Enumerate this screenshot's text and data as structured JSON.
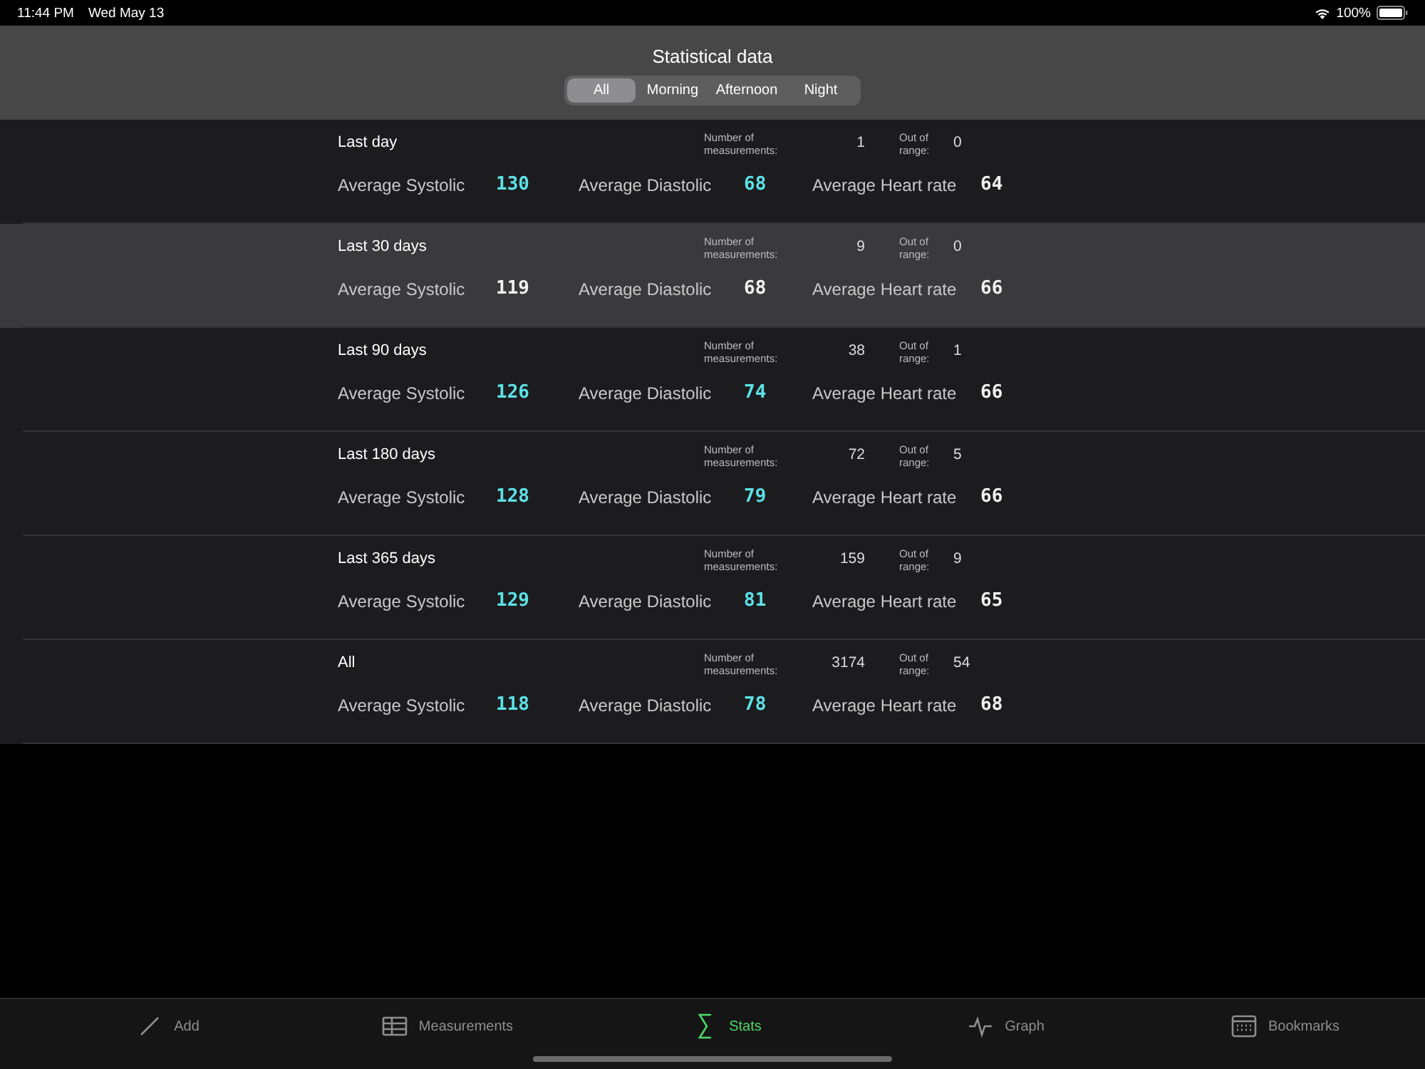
{
  "status_bar": {
    "time": "11:44 PM",
    "date": "Wed May 13",
    "battery": "100%"
  },
  "header": {
    "title": "Statistical data",
    "segments": [
      {
        "label": "All",
        "selected": true
      },
      {
        "label": "Morning",
        "selected": false
      },
      {
        "label": "Afternoon",
        "selected": false
      },
      {
        "label": "Night",
        "selected": false
      }
    ]
  },
  "rows": [
    {
      "period": "Last day",
      "selected": false,
      "count_label": "Number of measurements:",
      "count": "1",
      "range_label": "Out of range:",
      "out_of_range": "0",
      "stats": [
        {
          "label": "Average Systolic",
          "value": "130",
          "flagged": true
        },
        {
          "label": "Average Diastolic",
          "value": "68",
          "flagged": true
        },
        {
          "label": "Average Heart rate",
          "value": "64",
          "flagged": false
        }
      ]
    },
    {
      "period": "Last 30 days",
      "selected": true,
      "count_label": "Number of measurements:",
      "count": "9",
      "range_label": "Out of range:",
      "out_of_range": "0",
      "stats": [
        {
          "label": "Average Systolic",
          "value": "119",
          "flagged": false
        },
        {
          "label": "Average Diastolic",
          "value": "68",
          "flagged": false
        },
        {
          "label": "Average Heart rate",
          "value": "66",
          "flagged": false
        }
      ]
    },
    {
      "period": "Last 90 days",
      "selected": false,
      "count_label": "Number of measurements:",
      "count": "38",
      "range_label": "Out of range:",
      "out_of_range": "1",
      "stats": [
        {
          "label": "Average Systolic",
          "value": "126",
          "flagged": true
        },
        {
          "label": "Average Diastolic",
          "value": "74",
          "flagged": true
        },
        {
          "label": "Average Heart rate",
          "value": "66",
          "flagged": false
        }
      ]
    },
    {
      "period": "Last 180 days",
      "selected": false,
      "count_label": "Number of measurements:",
      "count": "72",
      "range_label": "Out of range:",
      "out_of_range": "5",
      "stats": [
        {
          "label": "Average Systolic",
          "value": "128",
          "flagged": true
        },
        {
          "label": "Average Diastolic",
          "value": "79",
          "flagged": true
        },
        {
          "label": "Average Heart rate",
          "value": "66",
          "flagged": false
        }
      ]
    },
    {
      "period": "Last 365 days",
      "selected": false,
      "count_label": "Number of measurements:",
      "count": "159",
      "range_label": "Out of range:",
      "out_of_range": "9",
      "stats": [
        {
          "label": "Average Systolic",
          "value": "129",
          "flagged": true
        },
        {
          "label": "Average Diastolic",
          "value": "81",
          "flagged": true
        },
        {
          "label": "Average Heart rate",
          "value": "65",
          "flagged": false
        }
      ]
    },
    {
      "period": "All",
      "selected": false,
      "count_label": "Number of measurements:",
      "count": "3174",
      "range_label": "Out of range:",
      "out_of_range": "54",
      "stats": [
        {
          "label": "Average Systolic",
          "value": "118",
          "flagged": true
        },
        {
          "label": "Average Diastolic",
          "value": "78",
          "flagged": true
        },
        {
          "label": "Average Heart rate",
          "value": "68",
          "flagged": false
        }
      ]
    }
  ],
  "tab_bar": [
    {
      "label": "Add",
      "kind": "pencil",
      "selected": false
    },
    {
      "label": "Measurements",
      "kind": "table",
      "selected": false
    },
    {
      "label": "Stats",
      "kind": "sigma",
      "selected": true
    },
    {
      "label": "Graph",
      "kind": "pulse",
      "selected": false
    },
    {
      "label": "Bookmarks",
      "kind": "calendar",
      "selected": false
    }
  ]
}
